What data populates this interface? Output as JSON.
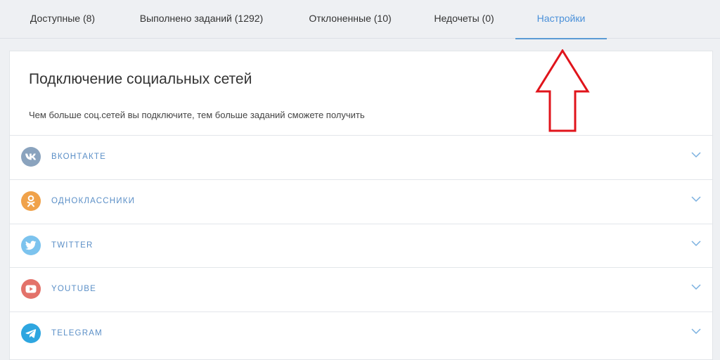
{
  "tabs": [
    {
      "label": "Доступные (8)",
      "active": false
    },
    {
      "label": "Выполнено заданий (1292)",
      "active": false
    },
    {
      "label": "Отклоненные (10)",
      "active": false
    },
    {
      "label": "Недочеты (0)",
      "active": false
    },
    {
      "label": "Настройки",
      "active": true
    }
  ],
  "section": {
    "title": "Подключение социальных сетей",
    "subtitle": "Чем больше соц.сетей вы подключите, тем больше заданий сможете получить"
  },
  "networks": [
    {
      "label": "ВКОНТАКТЕ",
      "icon": "vk-icon",
      "color": "#8aa3be"
    },
    {
      "label": "ОДНОКЛАССНИКИ",
      "icon": "odnoklassniki-icon",
      "color": "#f0a24a"
    },
    {
      "label": "TWITTER",
      "icon": "twitter-icon",
      "color": "#7cc3ee"
    },
    {
      "label": "YOUTUBE",
      "icon": "youtube-icon",
      "color": "#e3726a"
    },
    {
      "label": "TELEGRAM",
      "icon": "telegram-icon",
      "color": "#2ea6e0"
    }
  ],
  "colors": {
    "accent": "#4a90d9",
    "arrow": "#e0141b"
  }
}
